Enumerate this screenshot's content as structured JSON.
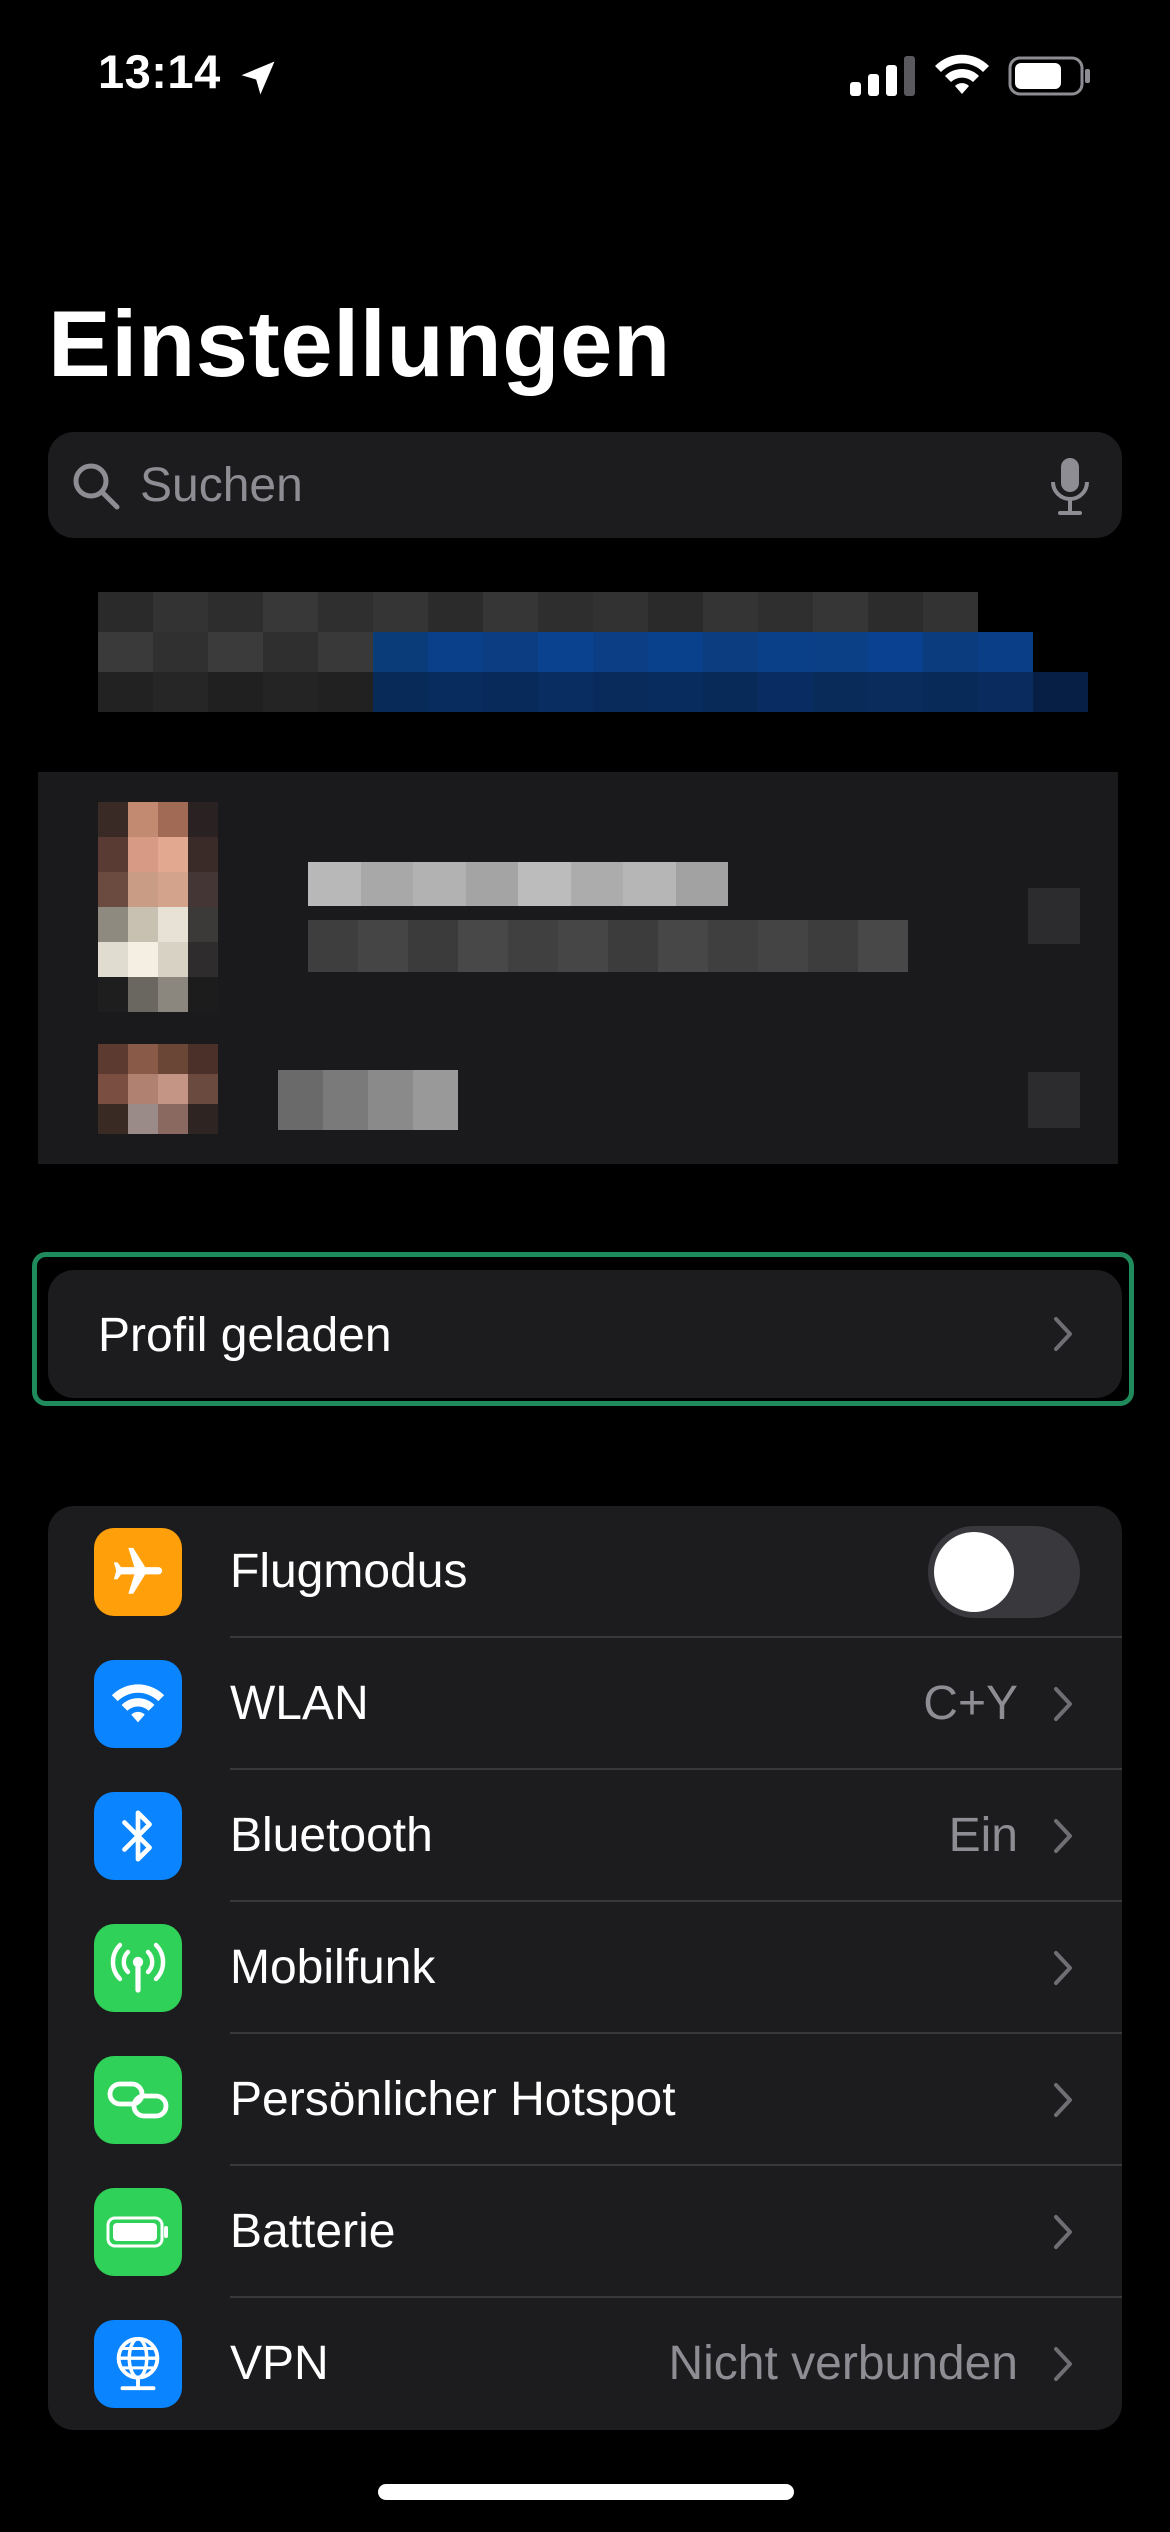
{
  "status_bar": {
    "time": "13:14",
    "icons": [
      "location-arrow-icon",
      "cellular-signal-icon",
      "wifi-icon",
      "battery-icon"
    ]
  },
  "page": {
    "title": "Einstellungen"
  },
  "search": {
    "placeholder": "Suchen",
    "value": ""
  },
  "profile_notice": {
    "label": "Profil geladen",
    "highlight_color": "#1f8a5b"
  },
  "settings": [
    {
      "label": "Flugmodus",
      "icon": "airplane-icon",
      "icon_color": "#ff9f0a",
      "type": "toggle",
      "on": false
    },
    {
      "label": "WLAN",
      "icon": "wifi-icon",
      "icon_color": "#0a84ff",
      "value": "C+Y",
      "type": "link"
    },
    {
      "label": "Bluetooth",
      "icon": "bluetooth-icon",
      "icon_color": "#0a84ff",
      "value": "Ein",
      "type": "link"
    },
    {
      "label": "Mobilfunk",
      "icon": "antenna-icon",
      "icon_color": "#30d158",
      "value": "",
      "type": "link"
    },
    {
      "label": "Persönlicher Hotspot",
      "icon": "hotspot-link-icon",
      "icon_color": "#30d158",
      "value": "",
      "type": "link"
    },
    {
      "label": "Batterie",
      "icon": "battery-icon",
      "icon_color": "#30d158",
      "value": "",
      "type": "link"
    },
    {
      "label": "VPN",
      "icon": "vpn-globe-icon",
      "icon_color": "#0a84ff",
      "value": "Nicht verbunden",
      "type": "link"
    }
  ],
  "colors": {
    "background": "#000000",
    "cell": "#1c1c1e",
    "secondary_text": "#8d8d93",
    "separator": "#38383a"
  }
}
